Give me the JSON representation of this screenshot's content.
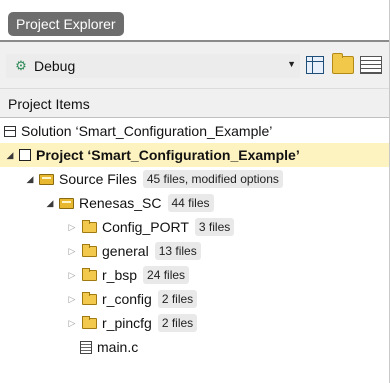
{
  "panel": {
    "title": "Project Explorer"
  },
  "config": {
    "selected": "Debug",
    "icon": "gear-icon"
  },
  "toolbar": {
    "buttons": [
      "grid-icon",
      "folder-icon",
      "properties-icon"
    ]
  },
  "section": {
    "header": "Project Items"
  },
  "tree": {
    "solution": {
      "label": "Solution ‘Smart_Configuration_Example’"
    },
    "project": {
      "label": "Project ‘Smart_Configuration_Example’"
    },
    "source_files": {
      "label": "Source Files",
      "badge": "45 files, modified options"
    },
    "renesas_sc": {
      "label": "Renesas_SC",
      "badge": "44 files"
    },
    "folders": [
      {
        "label": "Config_PORT",
        "badge": "3 files"
      },
      {
        "label": "general",
        "badge": "13 files"
      },
      {
        "label": "r_bsp",
        "badge": "24 files"
      },
      {
        "label": "r_config",
        "badge": "2 files"
      },
      {
        "label": "r_pincfg",
        "badge": "2 files"
      }
    ],
    "main_file": {
      "label": "main.c"
    }
  },
  "colors": {
    "selection": "#fdf3c0",
    "title_tab": "#6d6d6d",
    "header_bg": "#f0f0f0",
    "folder": "#f2c94c"
  }
}
